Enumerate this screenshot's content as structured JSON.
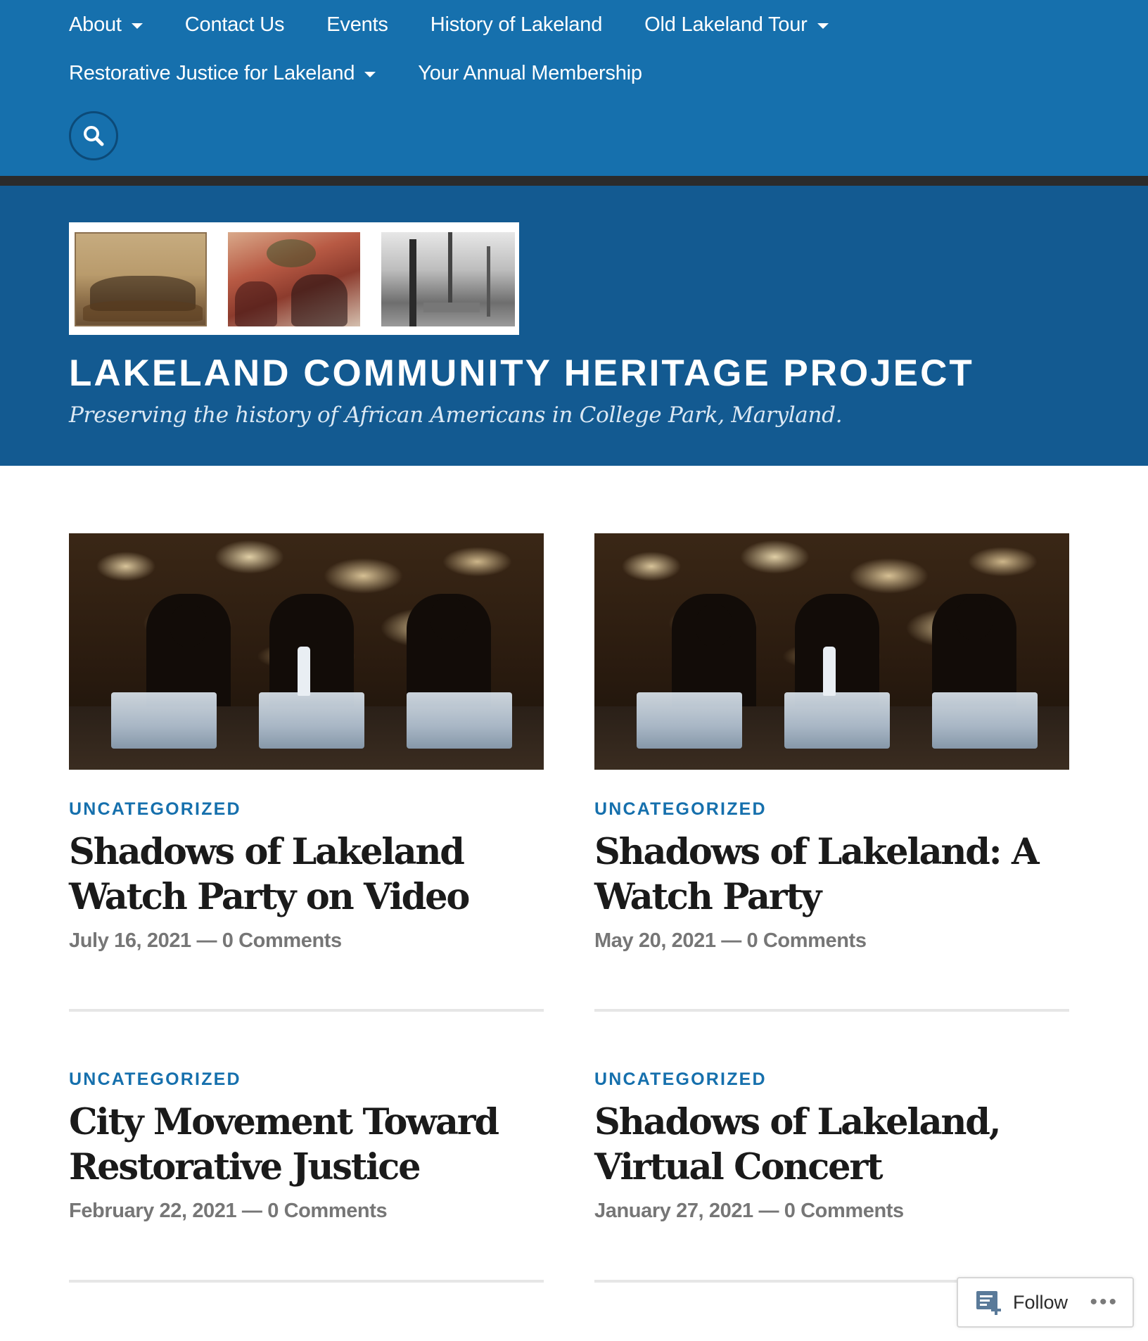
{
  "nav": {
    "row1": [
      {
        "label": "About",
        "dropdown": true
      },
      {
        "label": "Contact Us",
        "dropdown": false
      },
      {
        "label": "Events",
        "dropdown": false
      },
      {
        "label": "History of Lakeland",
        "dropdown": false
      },
      {
        "label": "Old Lakeland Tour",
        "dropdown": true
      }
    ],
    "row2": [
      {
        "label": "Restorative Justice for Lakeland",
        "dropdown": true
      },
      {
        "label": "Your Annual Membership",
        "dropdown": false
      }
    ],
    "search_icon": "search-icon"
  },
  "site": {
    "title": "LAKELAND COMMUNITY HERITAGE PROJECT",
    "tagline": "Preserving the history of African Americans in College Park, Maryland."
  },
  "posts": [
    {
      "category": "UNCATEGORIZED",
      "title": "Shadows of Lakeland Watch Party on Video",
      "date": "July 16, 2021",
      "separator": "—",
      "comments": "0 Comments",
      "has_image": true
    },
    {
      "category": "UNCATEGORIZED",
      "title": "Shadows of Lakeland: A Watch Party",
      "date": "May 20, 2021",
      "separator": "—",
      "comments": "0 Comments",
      "has_image": true
    },
    {
      "category": "UNCATEGORIZED",
      "title": "City Movement Toward Restorative Justice",
      "date": "February 22, 2021",
      "separator": "—",
      "comments": "0 Comments",
      "has_image": false
    },
    {
      "category": "UNCATEGORIZED",
      "title": "Shadows of Lakeland, Virtual Concert",
      "date": "January 27, 2021",
      "separator": "—",
      "comments": "0 Comments",
      "has_image": false
    }
  ],
  "follow_widget": {
    "label": "Follow",
    "icon": "reader-follow-icon",
    "more_icon": "ellipsis-icon",
    "more_text": "•••"
  },
  "colors": {
    "nav_bg": "#1670ad",
    "header_bg": "#135a91",
    "accent": "#1670ad",
    "title_text": "#1a1a1a",
    "meta_text": "#767676"
  }
}
